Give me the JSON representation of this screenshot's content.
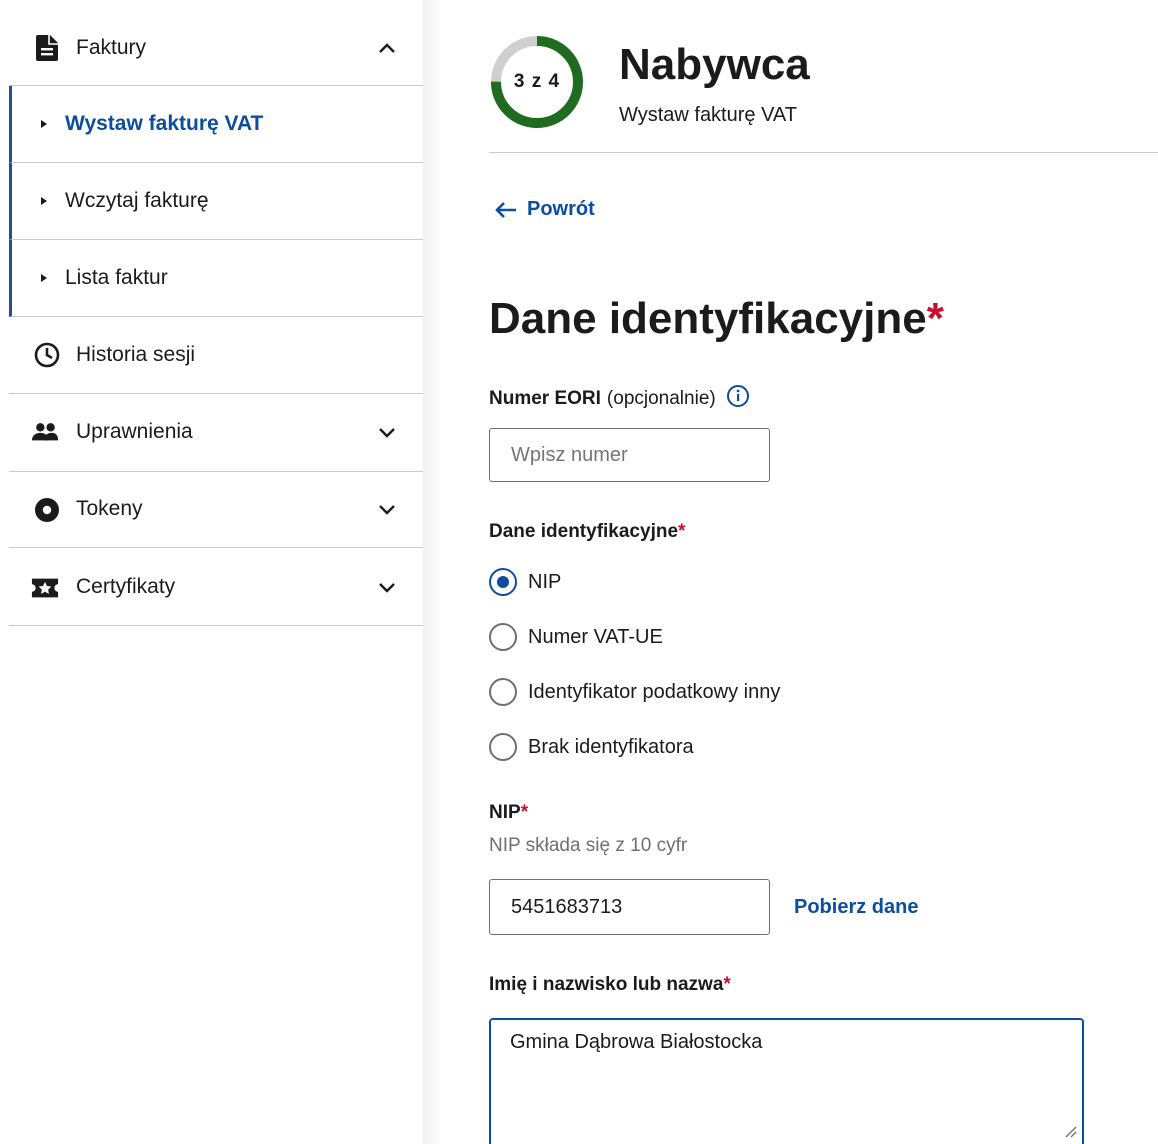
{
  "sidebar": {
    "faktury": {
      "label": "Faktury",
      "icon": "document-icon",
      "expanded": true
    },
    "sub_items": [
      {
        "label": "Wystaw fakturę VAT",
        "active": true
      },
      {
        "label": "Wczytaj fakturę",
        "active": false
      },
      {
        "label": "Lista faktur",
        "active": false
      }
    ],
    "historia": {
      "label": "Historia sesji",
      "icon": "clock-icon"
    },
    "uprawnienia": {
      "label": "Uprawnienia",
      "icon": "people-icon"
    },
    "tokeny": {
      "label": "Tokeny",
      "icon": "token-icon"
    },
    "certyfikaty": {
      "label": "Certyfikaty",
      "icon": "certificate-icon"
    }
  },
  "header": {
    "step": "3 z 4",
    "step_current": 3,
    "step_total": 4,
    "title": "Nabywca",
    "subtitle": "Wystaw fakturę VAT"
  },
  "back_label": "Powrót",
  "section_title": "Dane identyfikacyjne",
  "required_mark": "*",
  "eori": {
    "label": "Numer EORI",
    "optional": "(opcjonalnie)",
    "placeholder": "Wpisz numer",
    "value": ""
  },
  "identification": {
    "label": "Dane identyfikacyjne",
    "options": [
      {
        "label": "NIP",
        "checked": true
      },
      {
        "label": "Numer VAT-UE",
        "checked": false
      },
      {
        "label": "Identyfikator podatkowy inny",
        "checked": false
      },
      {
        "label": "Brak identyfikatora",
        "checked": false
      }
    ]
  },
  "nip": {
    "label": "NIP",
    "hint": "NIP składa się z 10 cyfr",
    "value": "5451683713",
    "fetch_label": "Pobierz dane"
  },
  "name": {
    "label": "Imię i nazwisko lub nazwa",
    "value": "Gmina Dąbrowa Białostocka"
  },
  "colors": {
    "accent": "#0b4d9e",
    "required": "#c8102e",
    "progress": "#1f6b1f",
    "progress_track": "#cfcfcf"
  }
}
